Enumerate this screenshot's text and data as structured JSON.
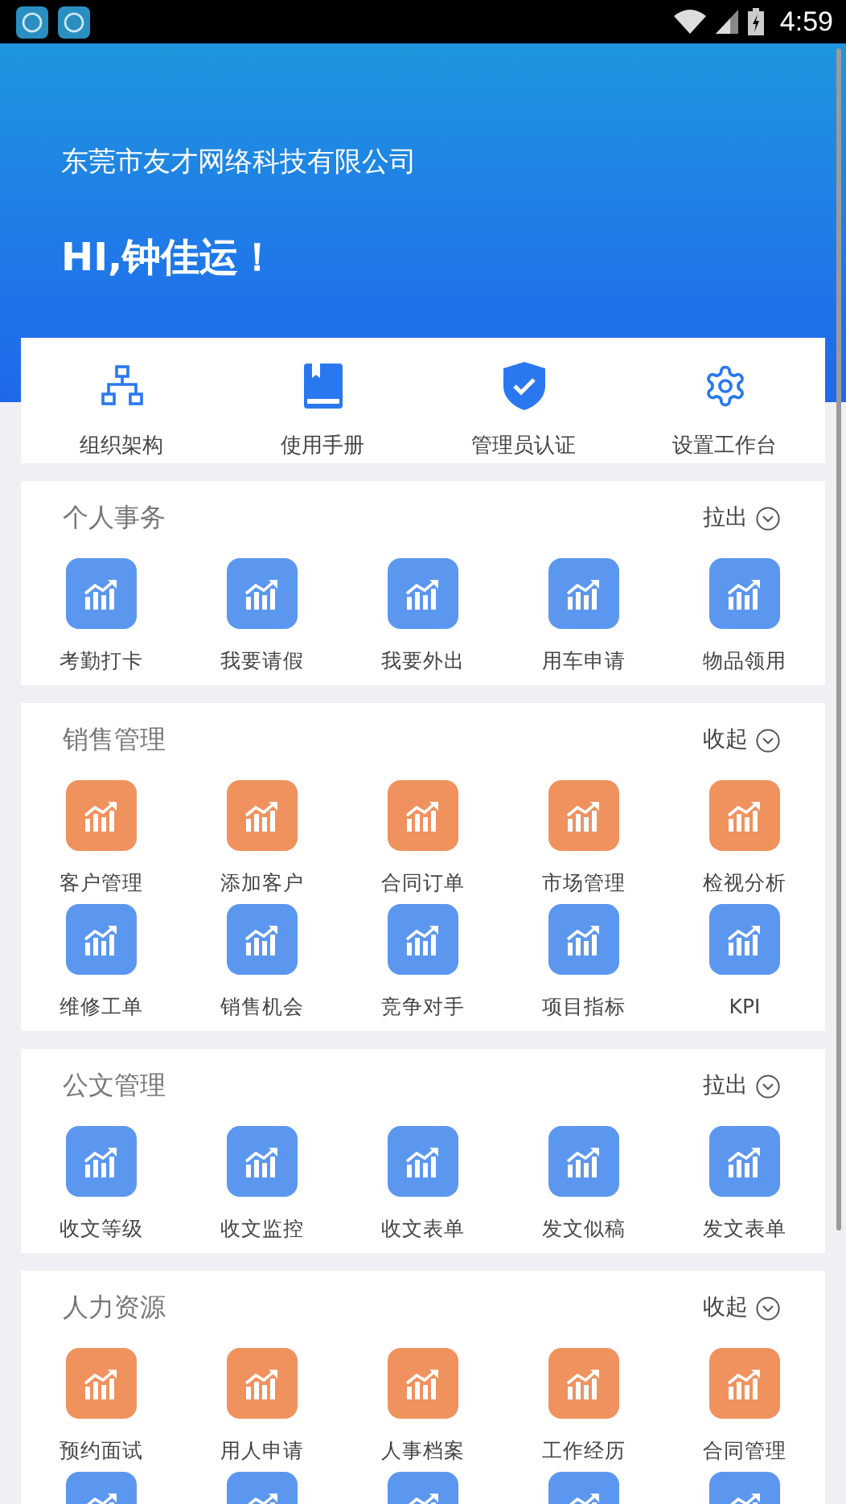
{
  "status_bar": {
    "time": "4:59"
  },
  "header": {
    "company": "东莞市友才网络科技有限公司",
    "greeting": "HI,钟佳运！"
  },
  "quick_actions": [
    {
      "kind": "org",
      "label": "组织架构"
    },
    {
      "kind": "book",
      "label": "使用手册"
    },
    {
      "kind": "shield",
      "label": "管理员认证"
    },
    {
      "kind": "gear",
      "label": "设置工作台"
    }
  ],
  "sections": [
    {
      "title": "个人事务",
      "toggle": "拉出",
      "items": [
        {
          "label": "考勤打卡",
          "color": "#5b97ef"
        },
        {
          "label": "我要请假",
          "color": "#5b97ef"
        },
        {
          "label": "我要外出",
          "color": "#5b97ef"
        },
        {
          "label": "用车申请",
          "color": "#5b97ef"
        },
        {
          "label": "物品领用",
          "color": "#5b97ef"
        }
      ]
    },
    {
      "title": "销售管理",
      "toggle": "收起",
      "items": [
        {
          "label": "客户管理",
          "color": "#f0925e"
        },
        {
          "label": "添加客户",
          "color": "#f0925e"
        },
        {
          "label": "合同订单",
          "color": "#f0925e"
        },
        {
          "label": "市场管理",
          "color": "#f0925e"
        },
        {
          "label": "检视分析",
          "color": "#f0925e"
        },
        {
          "label": "维修工单",
          "color": "#5b97ef"
        },
        {
          "label": "销售机会",
          "color": "#5b97ef"
        },
        {
          "label": "竞争对手",
          "color": "#5b97ef"
        },
        {
          "label": "项目指标",
          "color": "#5b97ef"
        },
        {
          "label": "KPI",
          "color": "#5b97ef"
        }
      ]
    },
    {
      "title": "公文管理",
      "toggle": "拉出",
      "items": [
        {
          "label": "收文等级",
          "color": "#5b97ef"
        },
        {
          "label": "收文监控",
          "color": "#5b97ef"
        },
        {
          "label": "收文表单",
          "color": "#5b97ef"
        },
        {
          "label": "发文似稿",
          "color": "#5b97ef"
        },
        {
          "label": "发文表单",
          "color": "#5b97ef"
        }
      ]
    },
    {
      "title": "人力资源",
      "toggle": "收起",
      "items": [
        {
          "label": "预约面试",
          "color": "#f0925e"
        },
        {
          "label": "用人申请",
          "color": "#f0925e"
        },
        {
          "label": "人事档案",
          "color": "#f0925e"
        },
        {
          "label": "工作经历",
          "color": "#f0925e"
        },
        {
          "label": "合同管理",
          "color": "#f0925e"
        },
        {
          "color": "#5b97ef"
        },
        {
          "color": "#5b97ef"
        },
        {
          "color": "#5b97ef"
        },
        {
          "color": "#5b97ef"
        },
        {
          "color": "#5b97ef"
        }
      ]
    }
  ]
}
